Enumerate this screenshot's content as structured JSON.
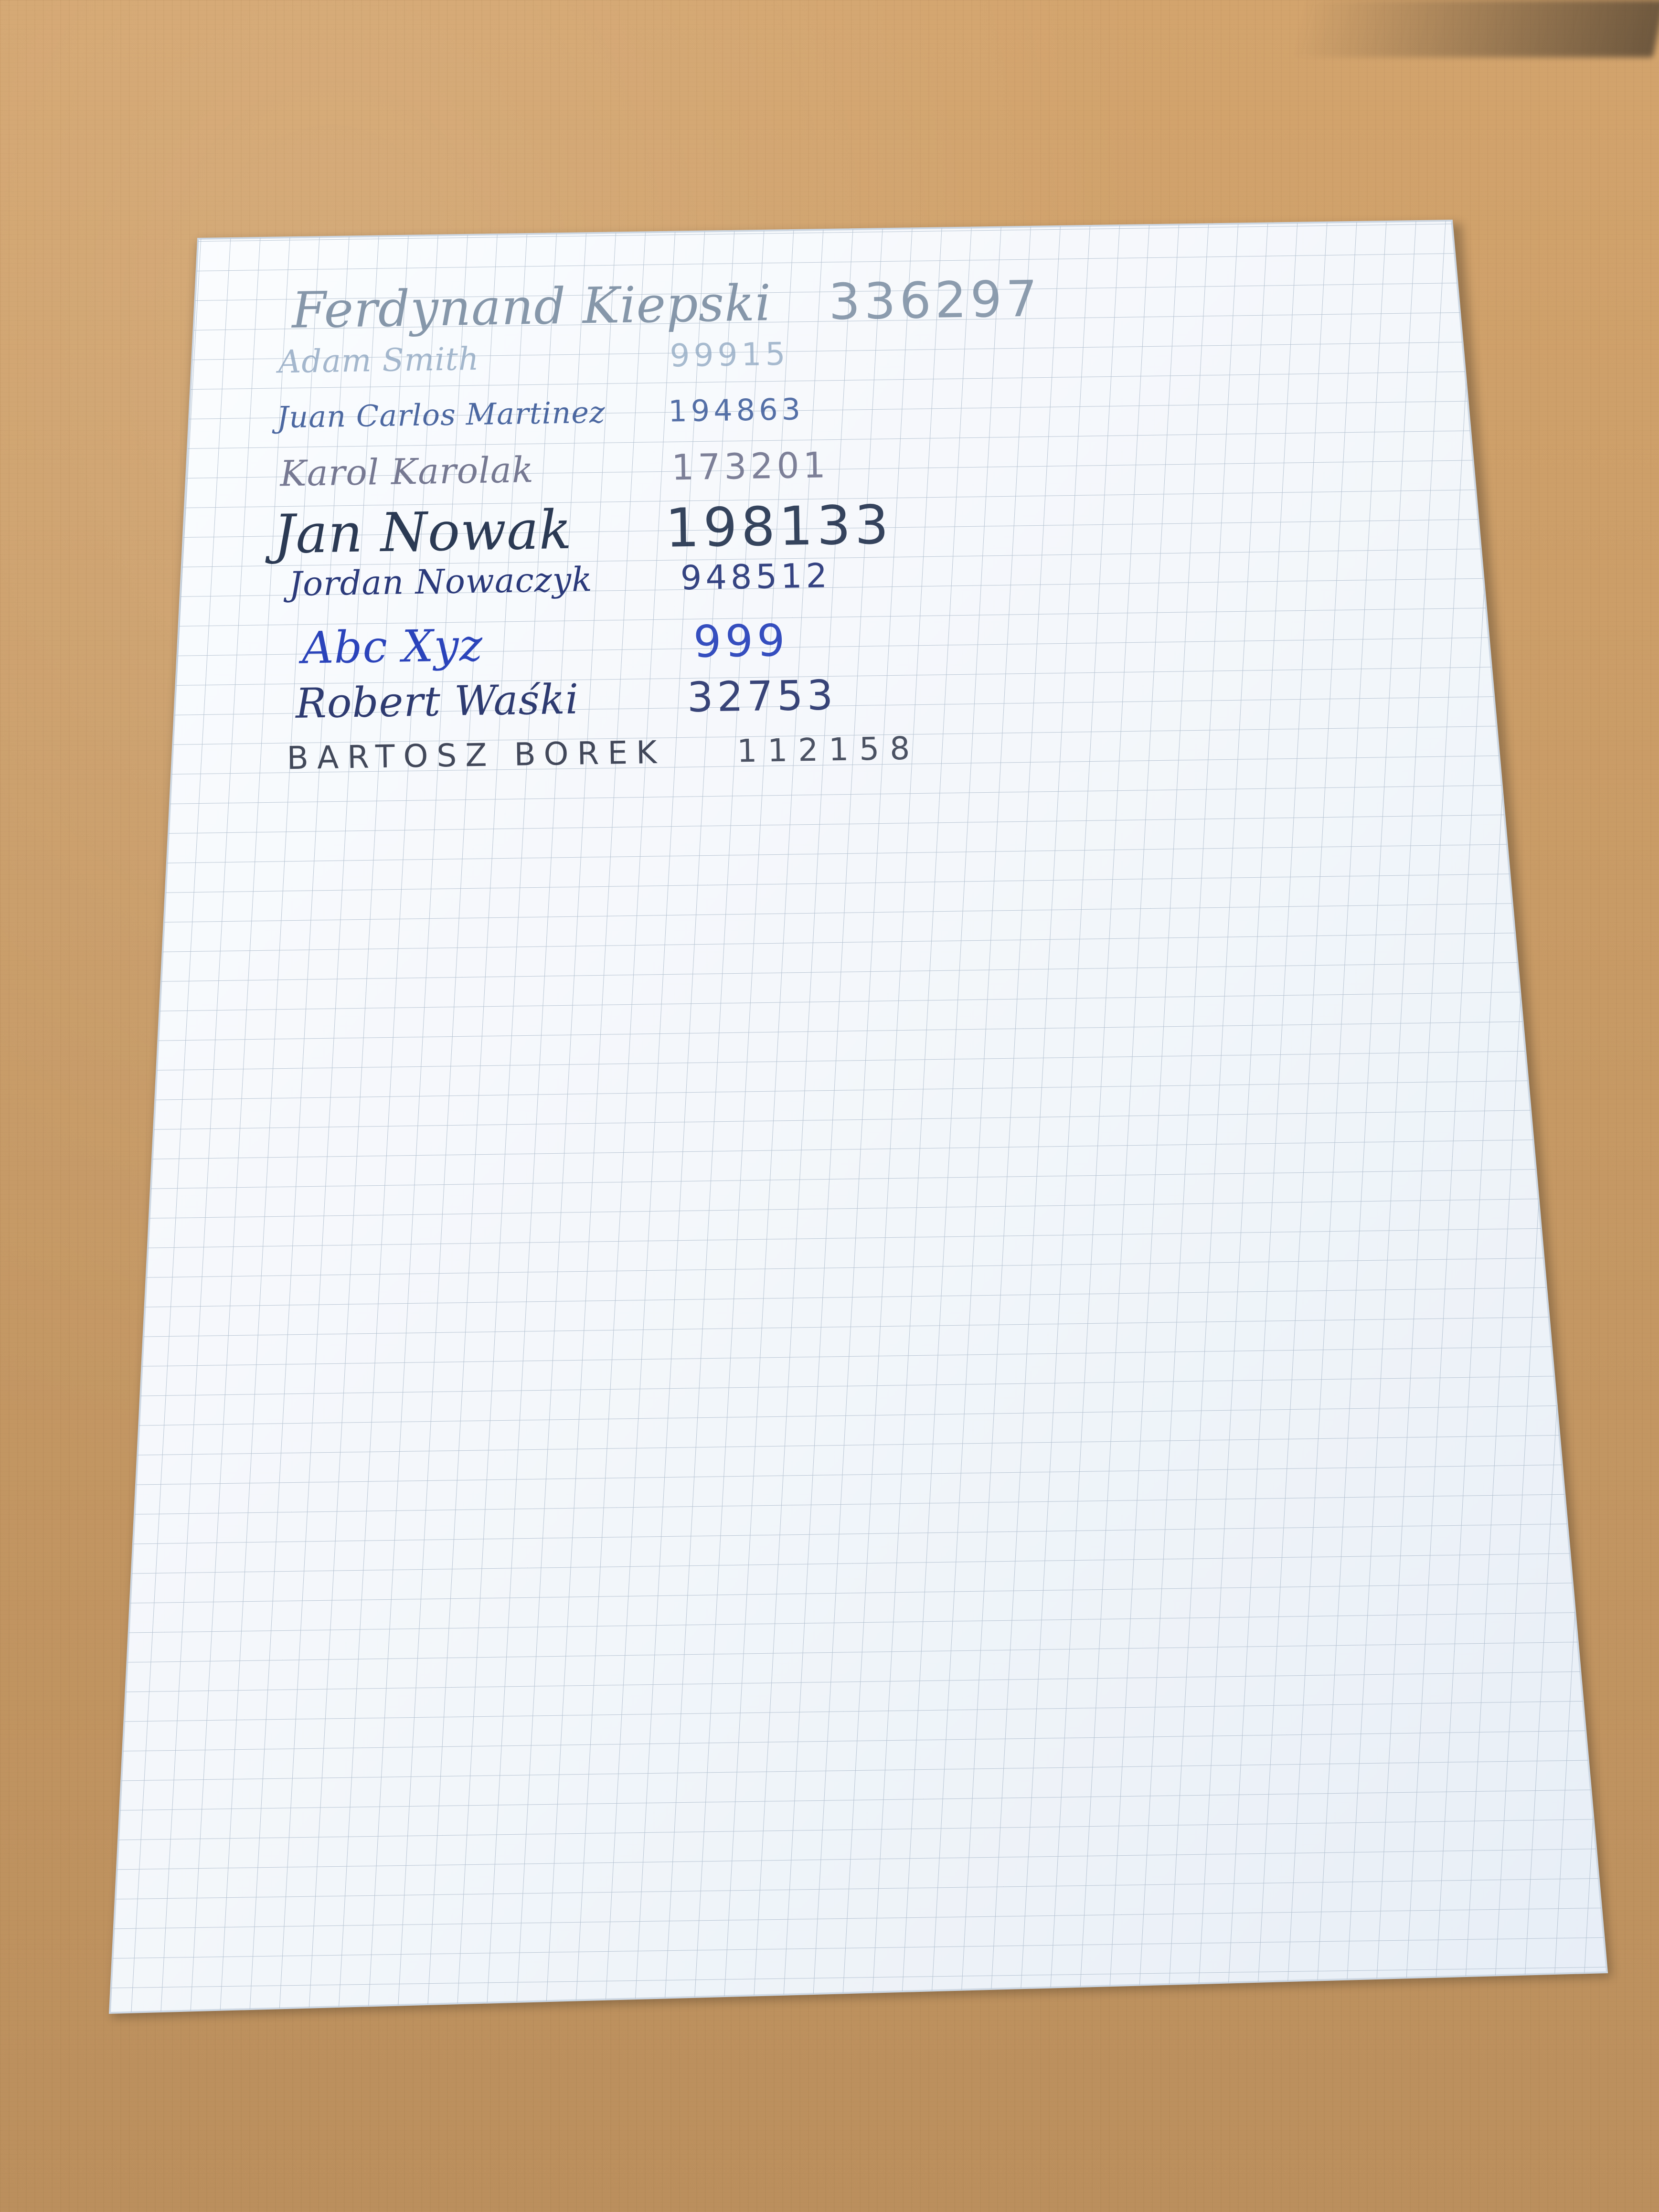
{
  "lines": [
    {
      "name": "Ferdynand Kiepski",
      "number": "336297"
    },
    {
      "name": "Adam Smith",
      "number": "99915"
    },
    {
      "name": "Juan Carlos Martinez",
      "number": "194863"
    },
    {
      "name": "Karol Karolak",
      "number": "173201"
    },
    {
      "name": "Jan Nowak",
      "number": "198133"
    },
    {
      "name": "Jordan Nowaczyk",
      "number": "948512"
    },
    {
      "name": "Abc Xyz",
      "number": "999"
    },
    {
      "name": "Robert Waśki",
      "number": "32753"
    },
    {
      "name": "BARTOSZ BOREK",
      "number": "112158"
    }
  ]
}
